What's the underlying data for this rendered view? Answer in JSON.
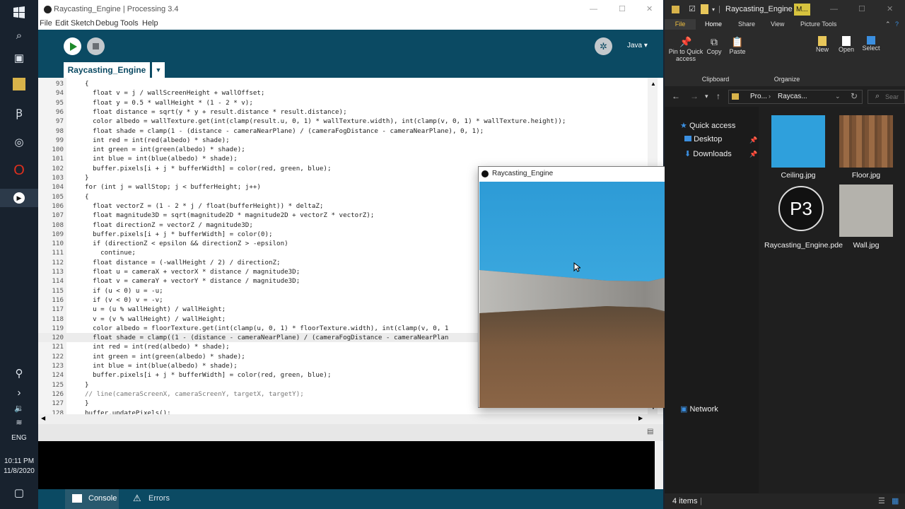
{
  "taskbar": {
    "language": "ENG",
    "time": "10:11 PM",
    "date": "11/8/2020"
  },
  "processing": {
    "title": "Raycasting_Engine | Processing 3.4",
    "menu": [
      "File",
      "Edit",
      "Sketch",
      "Debug",
      "Tools",
      "Help"
    ],
    "mode": "Java",
    "tab": "Raycasting_Engine",
    "bottom_tabs": {
      "console": "Console",
      "errors": "Errors"
    },
    "code": [
      {
        "n": "93",
        "t": "{"
      },
      {
        "n": "94",
        "t": "  float v = j / wallScreenHeight + wallOffset;"
      },
      {
        "n": "95",
        "t": "  float y = 0.5 * wallHeight * (1 - 2 * v);"
      },
      {
        "n": "96",
        "t": "  float distance = sqrt(y * y + result.distance * result.distance);"
      },
      {
        "n": "97",
        "t": "  color albedo = wallTexture.get(int(clamp(result.u, 0, 1) * wallTexture.width), int(clamp(v, 0, 1) * wallTexture.height));"
      },
      {
        "n": "98",
        "t": "  float shade = clamp(1 - (distance - cameraNearPlane) / (cameraFogDistance - cameraNearPlane), 0, 1);"
      },
      {
        "n": "99",
        "t": "  int red = int(red(albedo) * shade);"
      },
      {
        "n": "100",
        "t": "  int green = int(green(albedo) * shade);"
      },
      {
        "n": "101",
        "t": "  int blue = int(blue(albedo) * shade);"
      },
      {
        "n": "102",
        "t": "  buffer.pixels[i + j * bufferWidth] = color(red, green, blue);"
      },
      {
        "n": "103",
        "t": "}"
      },
      {
        "n": "104",
        "t": "for (int j = wallStop; j < bufferHeight; j++)"
      },
      {
        "n": "105",
        "t": "{"
      },
      {
        "n": "106",
        "t": "  float vectorZ = (1 - 2 * j / float(bufferHeight)) * deltaZ;"
      },
      {
        "n": "107",
        "t": "  float magnitude3D = sqrt(magnitude2D * magnitude2D + vectorZ * vectorZ);"
      },
      {
        "n": "108",
        "t": "  float directionZ = vectorZ / magnitude3D;"
      },
      {
        "n": "109",
        "t": "  buffer.pixels[i + j * bufferWidth] = color(0);"
      },
      {
        "n": "110",
        "t": "  if (directionZ < epsilon && directionZ > -epsilon)"
      },
      {
        "n": "111",
        "t": "    continue;"
      },
      {
        "n": "112",
        "t": "  float distance = (-wallHeight / 2) / directionZ;"
      },
      {
        "n": "113",
        "t": "  float u = cameraX + vectorX * distance / magnitude3D;"
      },
      {
        "n": "114",
        "t": "  float v = cameraY + vectorY * distance / magnitude3D;"
      },
      {
        "n": "115",
        "t": "  if (u < 0) u = -u;"
      },
      {
        "n": "116",
        "t": "  if (v < 0) v = -v;"
      },
      {
        "n": "117",
        "t": "  u = (u % wallHeight) / wallHeight;"
      },
      {
        "n": "118",
        "t": "  v = (v % wallHeight) / wallHeight;"
      },
      {
        "n": "119",
        "t": "  color albedo = floorTexture.get(int(clamp(u, 0, 1) * floorTexture.width), int(clamp(v, 0, 1"
      },
      {
        "n": "120",
        "t": "  float shade = clamp((1 - (distance - cameraNearPlane) / (cameraFogDistance - cameraNearPlan"
      },
      {
        "n": "121",
        "t": "  int red = int(red(albedo) * shade);"
      },
      {
        "n": "122",
        "t": "  int green = int(green(albedo) * shade);"
      },
      {
        "n": "123",
        "t": "  int blue = int(blue(albedo) * shade);"
      },
      {
        "n": "124",
        "t": "  buffer.pixels[i + j * bufferWidth] = color(red, green, blue);"
      },
      {
        "n": "125",
        "t": "}"
      },
      {
        "n": "126",
        "t": "// line(cameraScreenX, cameraScreenY, targetX, targetY);"
      },
      {
        "n": "127",
        "t": "}"
      },
      {
        "n": "128",
        "t": "buffer.updatePixels();"
      }
    ]
  },
  "render_window": {
    "title": "Raycasting_Engine"
  },
  "explorer": {
    "title": "Raycasting_Engine",
    "badge": "M...",
    "tabs": [
      "File",
      "Home",
      "Share",
      "View",
      "Picture Tools"
    ],
    "commands": {
      "pin": "Pin to Quick access",
      "copy": "Copy",
      "paste": "Paste",
      "new": "New",
      "open": "Open",
      "select": "Select"
    },
    "groups": {
      "clipboard": "Clipboard",
      "organize": "Organize"
    },
    "breadcrumb": [
      "Pro...",
      "Raycas..."
    ],
    "search_placeholder": "Sear",
    "nav": {
      "quick": "Quick access",
      "desktop": "Desktop",
      "downloads": "Downloads",
      "network": "Network"
    },
    "files": [
      "Ceiling.jpg",
      "Floor.jpg",
      "Raycasting_Engine.pde",
      "Wall.jpg"
    ],
    "status": "4 items"
  }
}
